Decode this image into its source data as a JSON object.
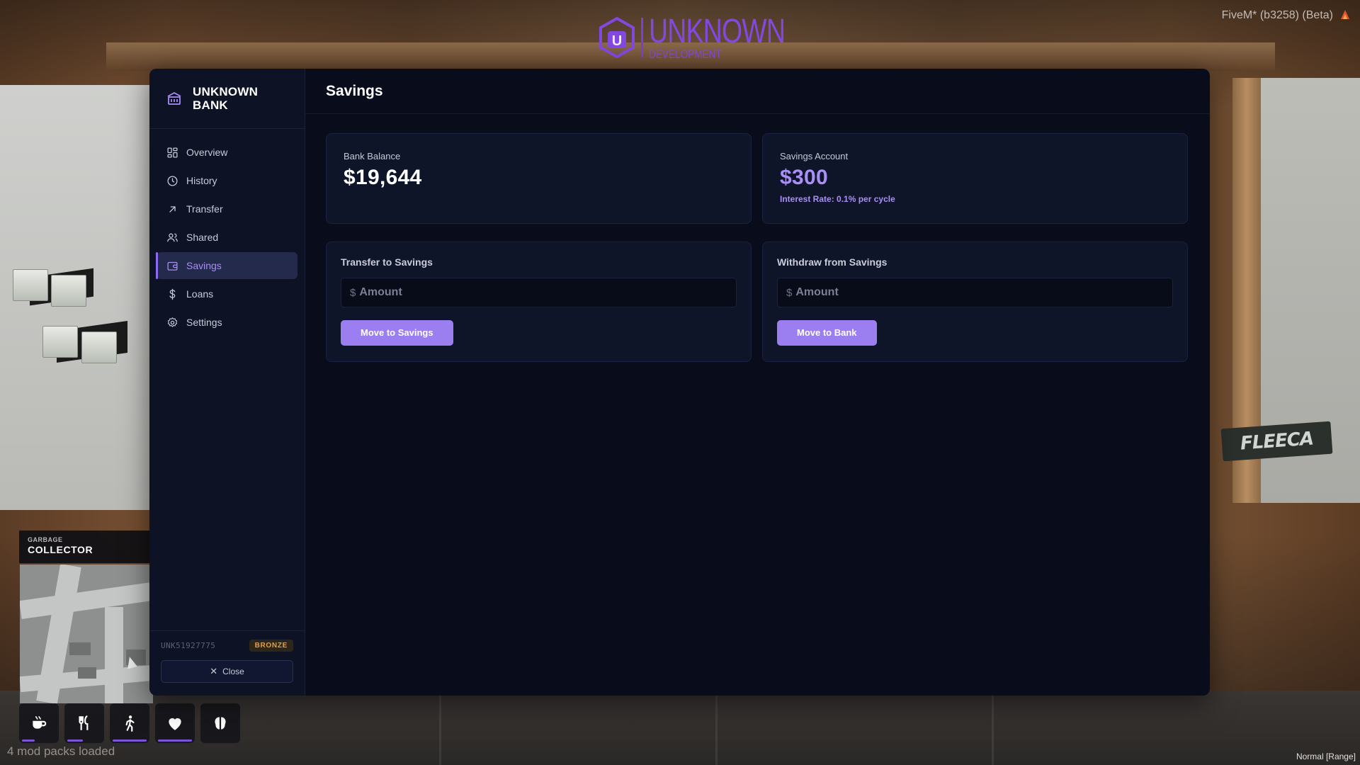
{
  "overlay": {
    "logo_word": "UNKNOWN",
    "logo_sub": "DEVELOPMENT",
    "logo_letter": "U",
    "fivem_version": "FiveM* (b3258) (Beta)",
    "mods_loaded": "4 mod packs loaded",
    "voice_mode": "Normal [Range]",
    "job_small": "GARBAGE",
    "job_big": "COLLECTOR"
  },
  "status_icons": [
    {
      "name": "coffee-icon"
    },
    {
      "name": "food-icon"
    },
    {
      "name": "stamina-icon"
    },
    {
      "name": "health-icon"
    },
    {
      "name": "stress-icon"
    }
  ],
  "sidebar": {
    "title_line1": "UNKNOWN",
    "title_line2": "BANK",
    "items": [
      {
        "label": "Overview",
        "icon": "grid-icon"
      },
      {
        "label": "History",
        "icon": "clock-icon"
      },
      {
        "label": "Transfer",
        "icon": "arrow-up-right-icon"
      },
      {
        "label": "Shared",
        "icon": "users-icon"
      },
      {
        "label": "Savings",
        "icon": "wallet-icon",
        "active": true
      },
      {
        "label": "Loans",
        "icon": "dollar-icon"
      },
      {
        "label": "Settings",
        "icon": "gear-icon"
      }
    ],
    "account_number": "UNK51927775",
    "tier_badge": "BRONZE",
    "close_label": "Close"
  },
  "main": {
    "title": "Savings",
    "bank_balance": {
      "label": "Bank Balance",
      "value": "$19,644"
    },
    "savings_account": {
      "label": "Savings Account",
      "value": "$300",
      "note": "Interest Rate: 0.1% per cycle"
    },
    "transfer": {
      "title": "Transfer to Savings",
      "currency": "$",
      "placeholder": "Amount",
      "button": "Move to Savings"
    },
    "withdraw": {
      "title": "Withdraw from Savings",
      "currency": "$",
      "placeholder": "Amount",
      "button": "Move to Bank"
    }
  },
  "colors": {
    "accent": "#9b7ff0",
    "accent_text": "#a98ef6",
    "panel": "#090d1b",
    "badge": "#e2a048"
  }
}
